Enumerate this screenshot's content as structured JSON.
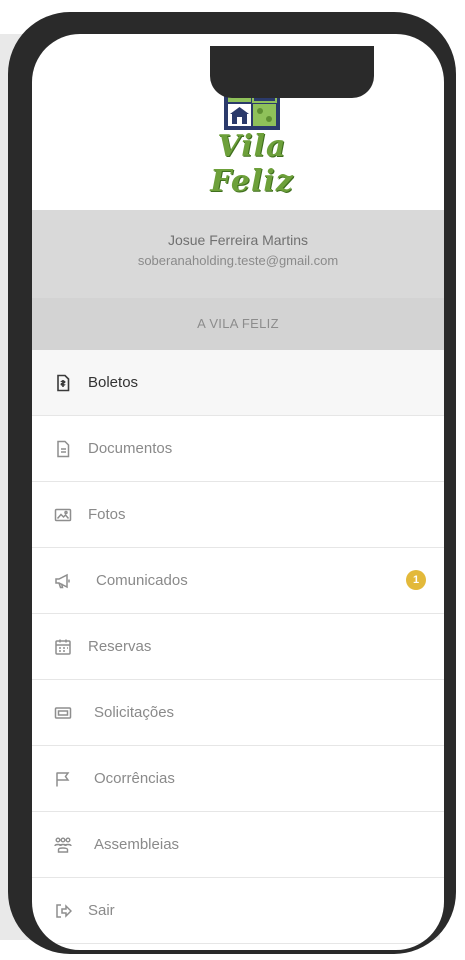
{
  "logo": {
    "text": "Vila Feliz",
    "colors": {
      "green": "#6da03a",
      "dark_green": "#3f6f1e",
      "navy": "#2b3a6b"
    }
  },
  "user": {
    "name": "Josue Ferreira Martins",
    "email": "soberanaholding.teste@gmail.com"
  },
  "condominium": {
    "name": "A VILA FELIZ"
  },
  "menu": {
    "items": [
      {
        "label": "Boletos",
        "icon": "boleto-icon",
        "active": true
      },
      {
        "label": "Documentos",
        "icon": "document-icon"
      },
      {
        "label": "Fotos",
        "icon": "photo-icon"
      },
      {
        "label": "Comunicados",
        "icon": "megaphone-icon",
        "badge": "1"
      },
      {
        "label": "Reservas",
        "icon": "calendar-icon"
      },
      {
        "label": "Solicitações",
        "icon": "ticket-icon"
      },
      {
        "label": "Ocorrências",
        "icon": "flag-icon"
      },
      {
        "label": "Assembleias",
        "icon": "group-icon"
      },
      {
        "label": "Sair",
        "icon": "logout-icon"
      }
    ]
  },
  "colors": {
    "badge": "#e3b93a",
    "header_gray": "#d9d9d9",
    "frame": "#2a2a2a"
  }
}
